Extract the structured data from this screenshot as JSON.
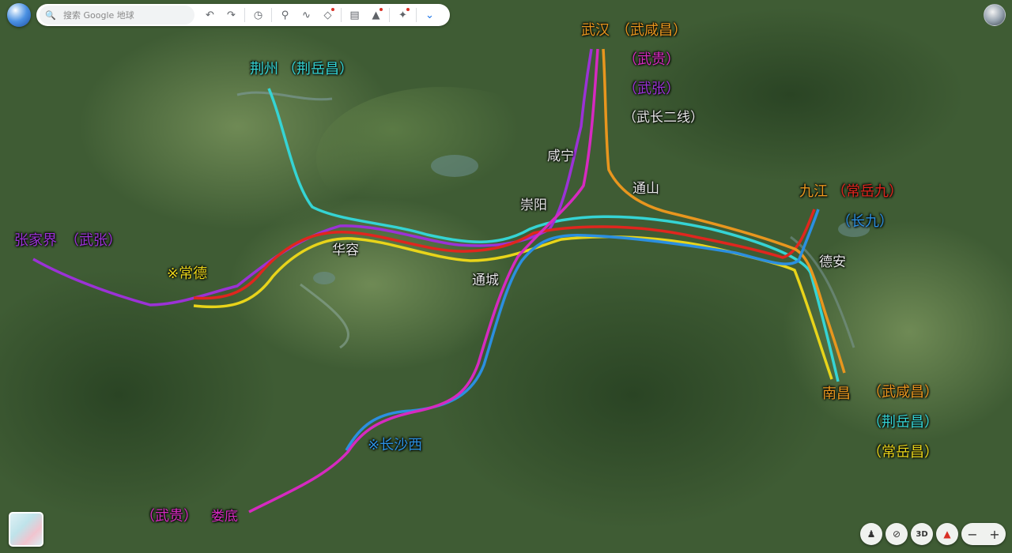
{
  "app": {
    "search_placeholder": "搜索 Google 地球",
    "toolbar_icons": [
      "search-icon",
      "undo-icon",
      "redo-icon",
      "history-icon",
      "placemark-icon",
      "path-icon",
      "layers-icon",
      "ruler-icon",
      "image-icon",
      "satellite-icon",
      "chevron-down-icon"
    ],
    "controls": {
      "three_d": "3D",
      "zoom_out": "−",
      "zoom_in": "+"
    }
  },
  "labels": {
    "wuhan": "武汉",
    "wuxianchang": "（武咸昌）",
    "wugui_top": "（武贵）",
    "wuzhang_top": "（武张）",
    "wuchang2": "（武长二线）",
    "jingzhou": "荆州",
    "jingyuechang_top": "（荆岳昌）",
    "xianning": "咸宁",
    "tongshan": "通山",
    "chongyang": "崇阳",
    "jiujiang": "九江",
    "changyuejiu": "（常岳九）",
    "changjiu": "（长九）",
    "dean": "德安",
    "zhangjiajie": "张家界",
    "wuzhang_left": "（武张）",
    "changde": "※常德",
    "huarong": "华容",
    "tongcheng": "通城",
    "nanchang": "南昌",
    "wuxianchang_bottom": "（武咸昌）",
    "jingyuechang_bottom": "（荆岳昌）",
    "changyuechang": "（常岳昌）",
    "changshaxi": "※长沙西",
    "wugui_bottom": "（武贵）",
    "loudi": "娄底"
  },
  "colors": {
    "cyan": "#35d4d4",
    "purple": "#9b32d6",
    "red": "#e0261e",
    "yellow": "#e8d41a",
    "orange": "#e8961e",
    "blue": "#2b8fe0",
    "magenta": "#d62ac0",
    "gray_label": "#e6e6e6"
  }
}
